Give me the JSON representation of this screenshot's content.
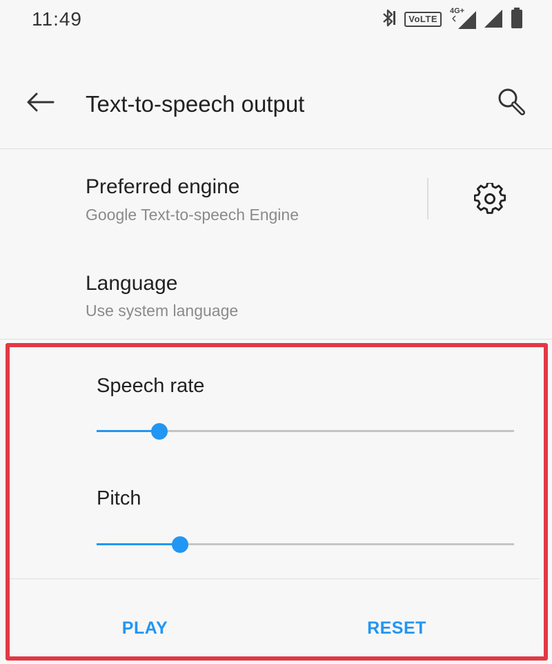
{
  "status_bar": {
    "time": "11:49",
    "volte_label": "VoLTE",
    "network_label": "4G+",
    "icons": [
      "bluetooth-icon",
      "volte-icon",
      "signal-icon",
      "signal-icon",
      "battery-icon"
    ]
  },
  "toolbar": {
    "back_icon": "arrow-left-icon",
    "title": "Text-to-speech output",
    "search_icon": "search-icon"
  },
  "preferred_engine": {
    "title": "Preferred engine",
    "value": "Google Text-to-speech Engine",
    "settings_icon": "gear-icon"
  },
  "language": {
    "title": "Language",
    "value": "Use system language"
  },
  "sliders": {
    "speech_rate": {
      "label": "Speech rate",
      "level": 0.15
    },
    "pitch": {
      "label": "Pitch",
      "level": 0.2
    }
  },
  "actions": {
    "play_label": "PLAY",
    "reset_label": "RESET"
  },
  "colors": {
    "accent": "#2196f3",
    "highlight": "#e23844",
    "background": "#f7f7f7"
  }
}
